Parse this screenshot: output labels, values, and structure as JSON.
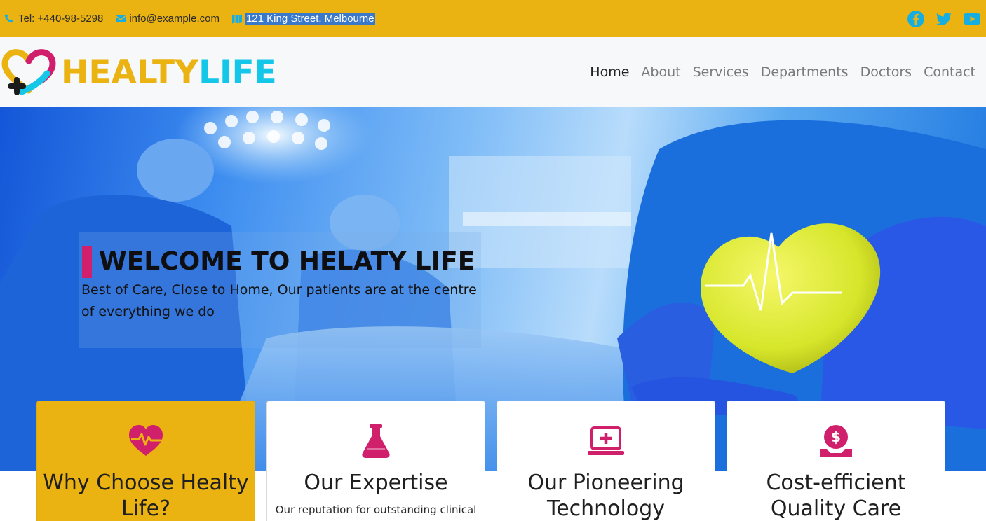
{
  "topbar": {
    "phone": "Tel: +440-98-5298",
    "email": "info@example.com",
    "address": "121 King Street, Melbourne",
    "icons": [
      "phone-icon",
      "envelope-icon",
      "map-icon"
    ],
    "socials": [
      "facebook-icon",
      "twitter-icon",
      "youtube-icon"
    ],
    "background_color": "#ebb311"
  },
  "brand": {
    "part1": "HEALTY",
    "part2": "LIFE",
    "colors": {
      "primary": "#ebb311",
      "secondary": "#14c7e9",
      "accent": "#d0206b"
    }
  },
  "nav": {
    "items": [
      "Home",
      "About",
      "Services",
      "Departments",
      "Doctors",
      "Contact"
    ],
    "active": "Home"
  },
  "hero": {
    "title": "WELCOME TO HELATY LIFE",
    "subtitle": "Best of Care, Close to Home, Our patients are at the centre of everything we do",
    "accent_color": "#d0206b"
  },
  "features": [
    {
      "title": "Why Choose Healty Life?",
      "text": "",
      "icon": "heart-pulse-icon",
      "highlight": true
    },
    {
      "title": "Our Expertise",
      "text": "Our reputation for outstanding clinical",
      "icon": "flask-icon",
      "highlight": false
    },
    {
      "title": "Our Pioneering Technology",
      "text": "",
      "icon": "laptop-medical-icon",
      "highlight": false
    },
    {
      "title": "Cost-efficient Quality Care",
      "text": "",
      "icon": "hand-dollar-icon",
      "highlight": false
    }
  ]
}
